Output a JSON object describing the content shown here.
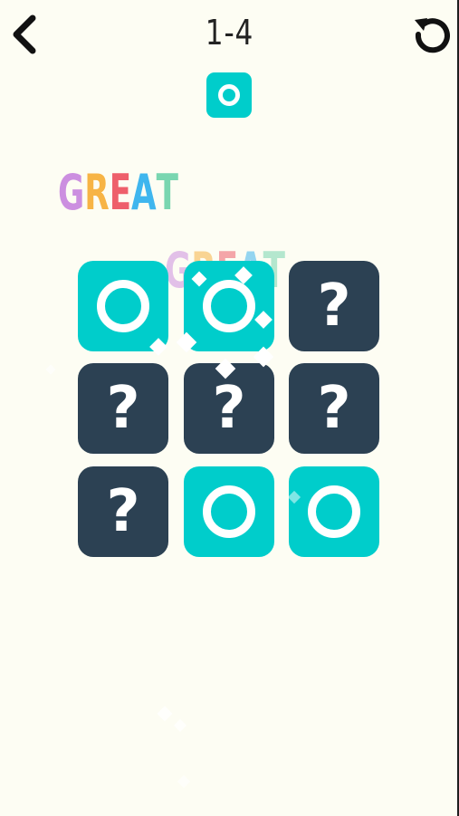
{
  "header": {
    "level": "1-4"
  },
  "effect": {
    "text": "GREAT",
    "letter_colors": [
      "#cc8fe0",
      "#f7b445",
      "#ee5f6b",
      "#3fb6ee",
      "#79d6b0"
    ]
  },
  "target": {
    "symbol": "circle",
    "color": "#00cdcb"
  },
  "grid": [
    {
      "state": "circle",
      "label": ""
    },
    {
      "state": "circle",
      "label": ""
    },
    {
      "state": "hidden",
      "label": "?"
    },
    {
      "state": "hidden",
      "label": "?"
    },
    {
      "state": "hidden",
      "label": "?"
    },
    {
      "state": "hidden",
      "label": "?"
    },
    {
      "state": "hidden",
      "label": "?"
    },
    {
      "state": "circle",
      "label": ""
    },
    {
      "state": "circle",
      "label": ""
    }
  ],
  "colors": {
    "revealed": "#00cdcb",
    "hidden": "#2c4153",
    "background": "#fdfdf3"
  },
  "icons": {
    "back": "chevron-left-icon",
    "restart": "restart-icon"
  }
}
